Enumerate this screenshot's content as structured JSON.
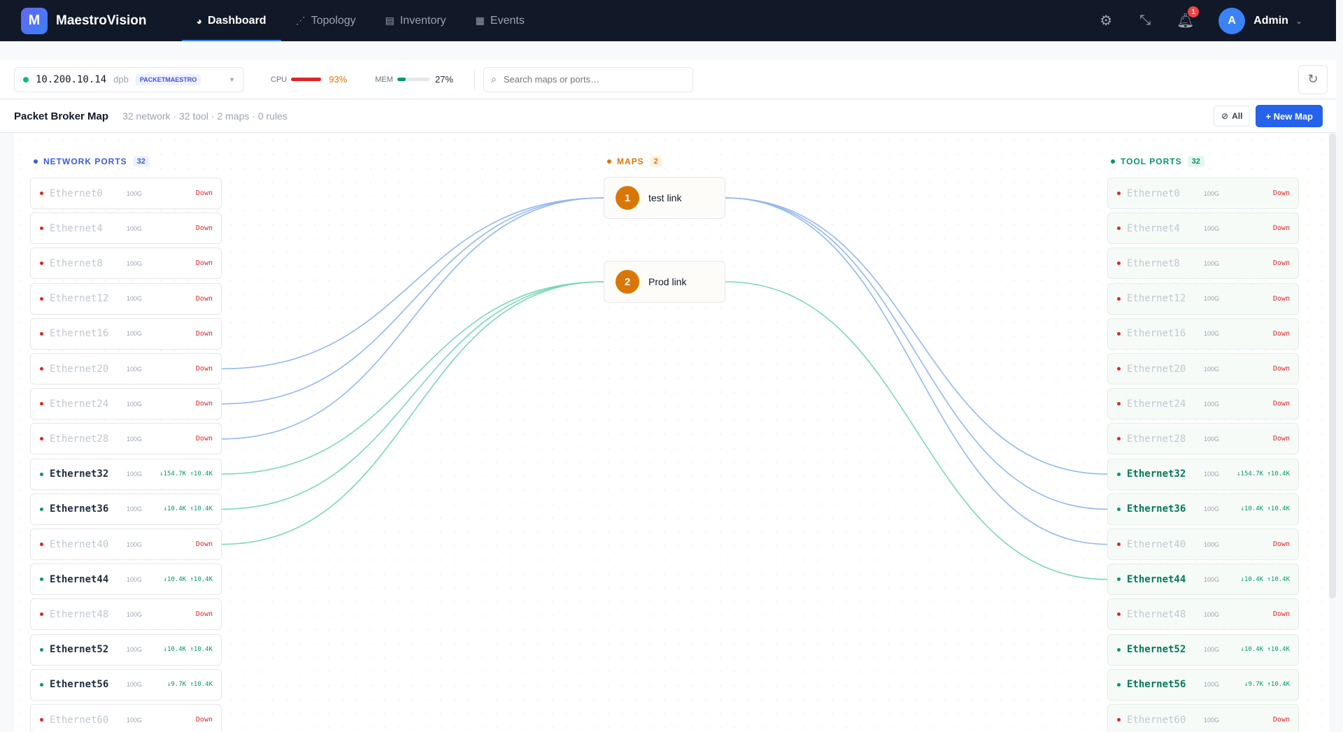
{
  "brand": {
    "logo_letter": "M",
    "name": "MaestroVision"
  },
  "nav": {
    "tabs": [
      {
        "label": "Dashboard",
        "icon": "dashboard-icon",
        "active": true
      },
      {
        "label": "Topology",
        "icon": "topology-icon"
      },
      {
        "label": "Inventory",
        "icon": "inventory-icon"
      },
      {
        "label": "Events",
        "icon": "events-icon"
      }
    ],
    "notification_count": "1",
    "user": {
      "initial": "A",
      "name": "Admin"
    }
  },
  "toolbar": {
    "device_ip": "10.200.10.14",
    "device_type": "dpb",
    "device_tag": "PACKETMAESTRO",
    "cpu": {
      "label": "CPU",
      "value": "93%",
      "level": 0.93,
      "color": "#dc2626"
    },
    "mem": {
      "label": "MEM",
      "value": "27%",
      "level": 0.27,
      "color": "#059669"
    },
    "search_placeholder": "Search maps or ports…"
  },
  "subheader": {
    "title": "Packet Broker Map",
    "stats": "32 network · 32 tool · 2 maps · 0 rules",
    "all_label": "All",
    "new_map_label": "+ New Map"
  },
  "columns": {
    "network": {
      "title": "NETWORK PORTS",
      "count": "32",
      "color": "#3b5bdb"
    },
    "maps": {
      "title": "MAPS",
      "count": "2",
      "color": "#d97706"
    },
    "tool": {
      "title": "TOOL PORTS",
      "count": "32",
      "color": "#059669"
    }
  },
  "network_ports": [
    {
      "name": "Ethernet0",
      "speed": "100G",
      "status": "Down"
    },
    {
      "name": "Ethernet4",
      "speed": "100G",
      "status": "Down"
    },
    {
      "name": "Ethernet8",
      "speed": "100G",
      "status": "Down"
    },
    {
      "name": "Ethernet12",
      "speed": "100G",
      "status": "Down"
    },
    {
      "name": "Ethernet16",
      "speed": "100G",
      "status": "Down"
    },
    {
      "name": "Ethernet20",
      "speed": "100G",
      "status": "Down"
    },
    {
      "name": "Ethernet24",
      "speed": "100G",
      "status": "Down"
    },
    {
      "name": "Ethernet28",
      "speed": "100G",
      "status": "Down"
    },
    {
      "name": "Ethernet32",
      "speed": "100G",
      "status": "↓154.7K ↑10.4K",
      "up": true
    },
    {
      "name": "Ethernet36",
      "speed": "100G",
      "status": "↓10.4K ↑10.4K",
      "up": true
    },
    {
      "name": "Ethernet40",
      "speed": "100G",
      "status": "Down"
    },
    {
      "name": "Ethernet44",
      "speed": "100G",
      "status": "↓10.4K ↑10.4K",
      "up": true
    },
    {
      "name": "Ethernet48",
      "speed": "100G",
      "status": "Down"
    },
    {
      "name": "Ethernet52",
      "speed": "100G",
      "status": "↓10.4K ↑10.4K",
      "up": true
    },
    {
      "name": "Ethernet56",
      "speed": "100G",
      "status": "↓9.7K ↑10.4K",
      "up": true
    },
    {
      "name": "Ethernet60",
      "speed": "100G",
      "status": "Down"
    }
  ],
  "tool_ports": [
    {
      "name": "Ethernet0",
      "speed": "100G",
      "status": "Down"
    },
    {
      "name": "Ethernet4",
      "speed": "100G",
      "status": "Down"
    },
    {
      "name": "Ethernet8",
      "speed": "100G",
      "status": "Down"
    },
    {
      "name": "Ethernet12",
      "speed": "100G",
      "status": "Down"
    },
    {
      "name": "Ethernet16",
      "speed": "100G",
      "status": "Down"
    },
    {
      "name": "Ethernet20",
      "speed": "100G",
      "status": "Down"
    },
    {
      "name": "Ethernet24",
      "speed": "100G",
      "status": "Down"
    },
    {
      "name": "Ethernet28",
      "speed": "100G",
      "status": "Down"
    },
    {
      "name": "Ethernet32",
      "speed": "100G",
      "status": "↓154.7K ↑10.4K",
      "up": true
    },
    {
      "name": "Ethernet36",
      "speed": "100G",
      "status": "↓10.4K ↑10.4K",
      "up": true
    },
    {
      "name": "Ethernet40",
      "speed": "100G",
      "status": "Down"
    },
    {
      "name": "Ethernet44",
      "speed": "100G",
      "status": "↓10.4K ↑10.4K",
      "up": true
    },
    {
      "name": "Ethernet48",
      "speed": "100G",
      "status": "Down"
    },
    {
      "name": "Ethernet52",
      "speed": "100G",
      "status": "↓10.4K ↑10.4K",
      "up": true
    },
    {
      "name": "Ethernet56",
      "speed": "100G",
      "status": "↓9.7K ↑10.4K",
      "up": true
    },
    {
      "name": "Ethernet60",
      "speed": "100G",
      "status": "Down"
    }
  ],
  "maps": [
    {
      "num": "1",
      "name": "test link",
      "color": "#93b8ec",
      "sources": [
        5,
        6,
        7
      ],
      "destinations": [
        8,
        9,
        10
      ]
    },
    {
      "num": "2",
      "name": "Prod link",
      "color": "#7ad8b4",
      "sources": [
        8,
        9,
        10
      ],
      "destinations": [
        11
      ]
    }
  ]
}
